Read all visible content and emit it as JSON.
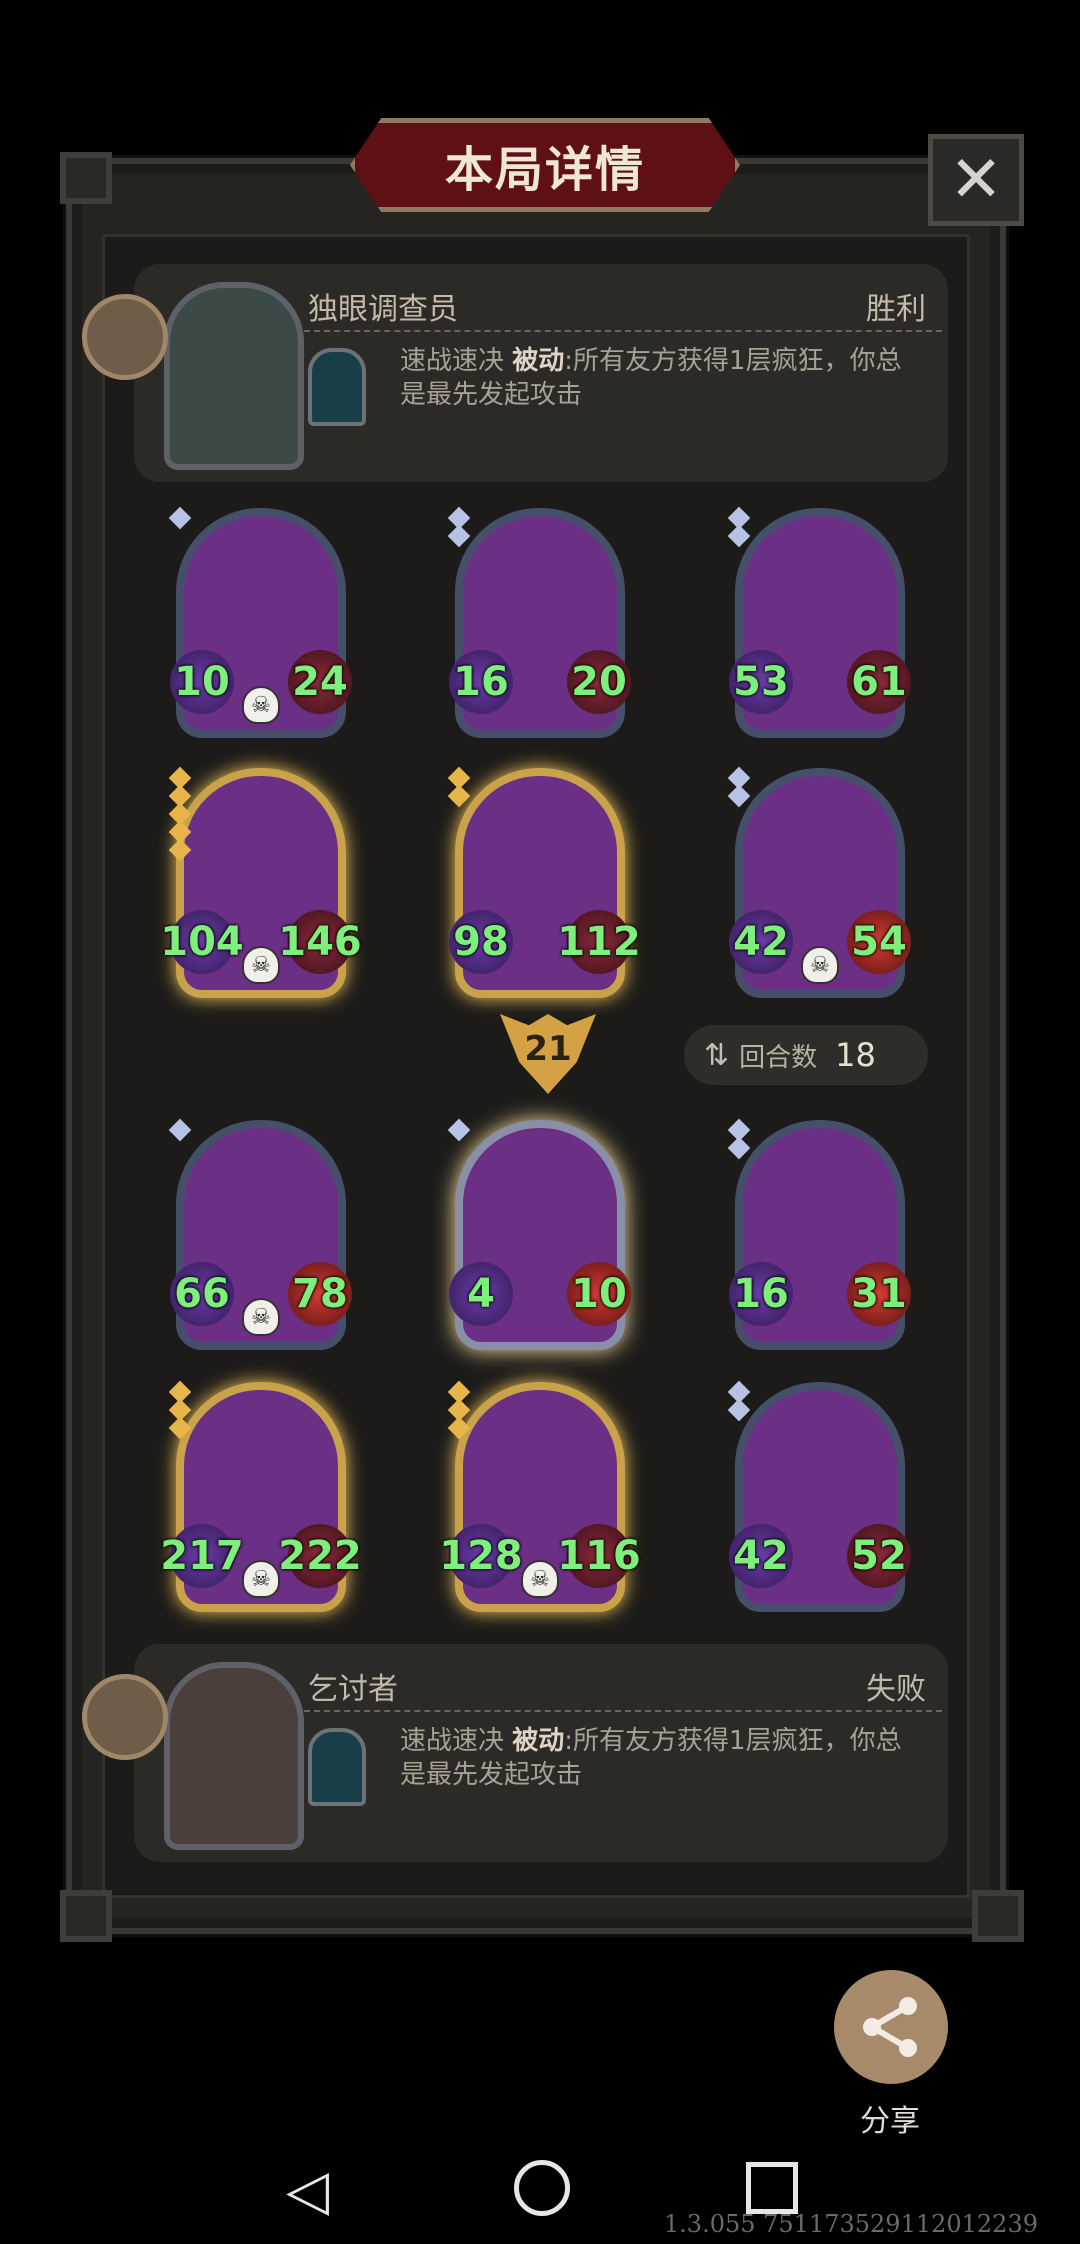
{
  "title": "本局详情",
  "close_icon": "✕",
  "top_player": {
    "name": "独眼调查员",
    "result": "胜利",
    "skill_name": "速战速决",
    "skill_type": "被动",
    "skill_desc": ":所有友方获得1层疯狂，你总是最先发起攻击"
  },
  "bottom_player": {
    "name": "乞讨者",
    "result": "失败",
    "skill_name": "速战速决",
    "skill_type": "被动",
    "skill_desc": ":所有友方获得1层疯狂，你总是最先发起攻击"
  },
  "top_cards": [
    {
      "attack": "10",
      "health": "24"
    },
    {
      "attack": "16",
      "health": "20"
    },
    {
      "attack": "53",
      "health": "61"
    },
    {
      "attack": "104",
      "health": "146"
    },
    {
      "attack": "98",
      "health": "112"
    },
    {
      "attack": "42",
      "health": "54"
    }
  ],
  "round_badge": "21",
  "rounds": {
    "label": "回合数",
    "value": "18"
  },
  "bottom_cards": [
    {
      "attack": "66",
      "health": "78"
    },
    {
      "attack": "4",
      "health": "10"
    },
    {
      "attack": "16",
      "health": "31"
    },
    {
      "attack": "217",
      "health": "222"
    },
    {
      "attack": "128",
      "health": "116"
    },
    {
      "attack": "42",
      "health": "52"
    }
  ],
  "share_label": "分享",
  "version": "1.3.055 751173529112012239",
  "skull_glyph": "☠"
}
